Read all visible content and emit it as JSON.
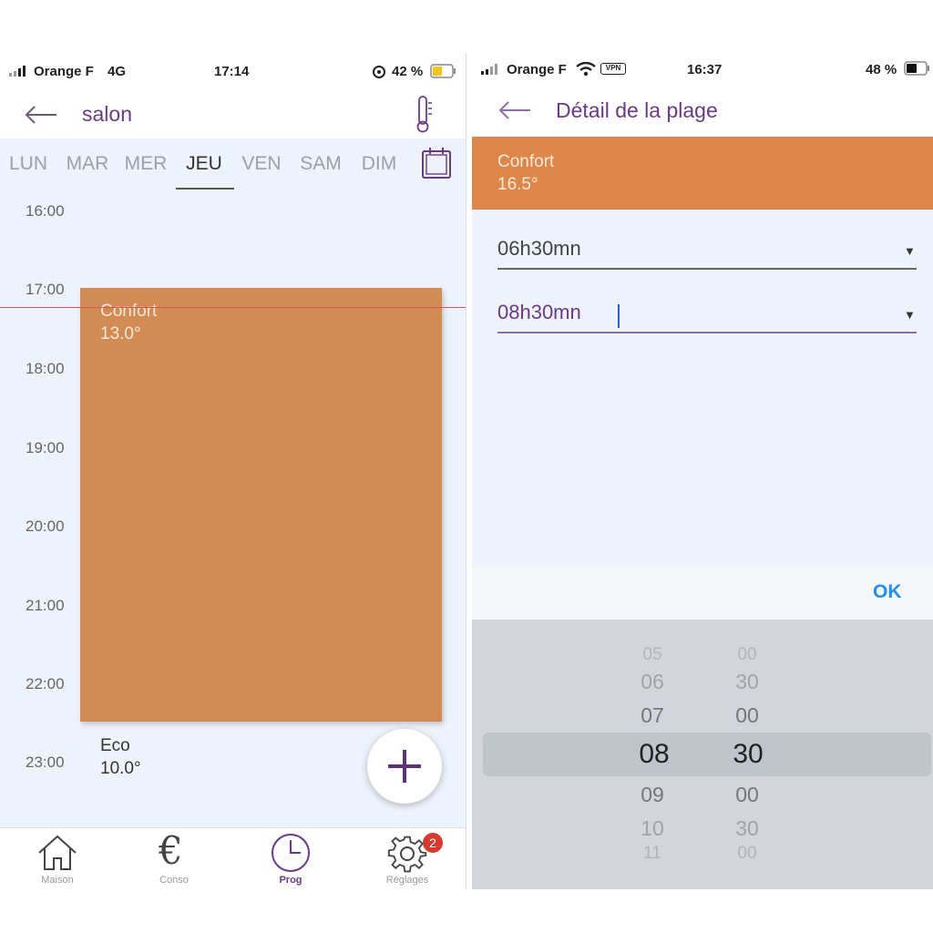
{
  "left": {
    "status": {
      "carrier": "Orange F",
      "network": "4G",
      "time": "17:14",
      "battery": "42 %"
    },
    "header": {
      "title": "salon"
    },
    "days": [
      "LUN",
      "MAR",
      "MER",
      "JEU",
      "VEN",
      "SAM",
      "DIM"
    ],
    "active_day": "JEU",
    "hours": [
      "16:00",
      "17:00",
      "18:00",
      "19:00",
      "20:00",
      "21:00",
      "22:00",
      "23:00"
    ],
    "block": {
      "name": "Confort",
      "temp": "13.0°",
      "color": "#d38b54"
    },
    "eco": {
      "name": "Eco",
      "temp": "10.0°"
    },
    "tabs": [
      {
        "label": "Maison",
        "icon": "house-icon"
      },
      {
        "label": "Conso",
        "icon": "euro-icon"
      },
      {
        "label": "Prog",
        "icon": "clock-icon"
      },
      {
        "label": "Réglages",
        "icon": "gear-icon"
      }
    ],
    "badge_count": "2"
  },
  "right": {
    "status": {
      "carrier": "Orange F",
      "vpn": "VPN",
      "time": "16:37",
      "battery": "48 %"
    },
    "header": {
      "title": "Détail de la plage"
    },
    "mode": {
      "name": "Confort",
      "temp": "16.5°",
      "color": "#dd874a"
    },
    "start_value": "06h30mn",
    "end_value": "08h30mn",
    "ok_label": "OK",
    "picker": {
      "hours": [
        "05",
        "06",
        "07",
        "08",
        "09",
        "10",
        "11"
      ],
      "minutes": [
        "00",
        "30",
        "00",
        "30",
        "00",
        "30",
        "00"
      ],
      "selected_hour": "08",
      "selected_minute": "30"
    }
  },
  "colors": {
    "brand_purple": "#6b3a87",
    "ios_blue": "#1f8ef5",
    "now_line": "#d9535a"
  }
}
